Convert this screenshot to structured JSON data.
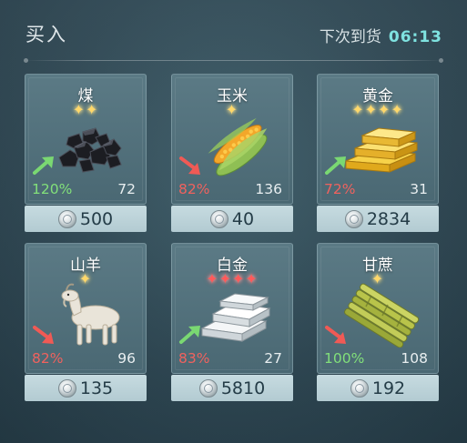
{
  "header": {
    "title": "买入",
    "restock_label": "下次到货",
    "restock_time": "06:13"
  },
  "items": [
    {
      "name": "煤",
      "stars": 2,
      "star_color": "gold",
      "trend": "up",
      "percent": "120%",
      "quantity": "72",
      "price": "500",
      "icon": "coal-icon"
    },
    {
      "name": "玉米",
      "stars": 1,
      "star_color": "gold",
      "trend": "down",
      "percent": "82%",
      "quantity": "136",
      "price": "40",
      "icon": "corn-icon"
    },
    {
      "name": "黄金",
      "stars": 4,
      "star_color": "gold",
      "trend": "up",
      "percent": "72%",
      "quantity": "31",
      "price": "2834",
      "icon": "gold-bars-icon"
    },
    {
      "name": "山羊",
      "stars": 1,
      "star_color": "gold",
      "trend": "down",
      "percent": "82%",
      "quantity": "96",
      "price": "135",
      "icon": "goat-icon"
    },
    {
      "name": "白金",
      "stars": 4,
      "star_color": "red",
      "trend": "up",
      "percent": "83%",
      "quantity": "27",
      "price": "5810",
      "icon": "platinum-bars-icon"
    },
    {
      "name": "甘蔗",
      "stars": 1,
      "star_color": "gold",
      "trend": "down",
      "percent": "100%",
      "quantity": "108",
      "price": "192",
      "icon": "sugarcane-icon"
    }
  ],
  "colors": {
    "up": "#82e07a",
    "down": "#f0625e",
    "accent": "#7fe3e0",
    "star_gold": "#ffd86a",
    "star_red": "#ff5a5a"
  }
}
